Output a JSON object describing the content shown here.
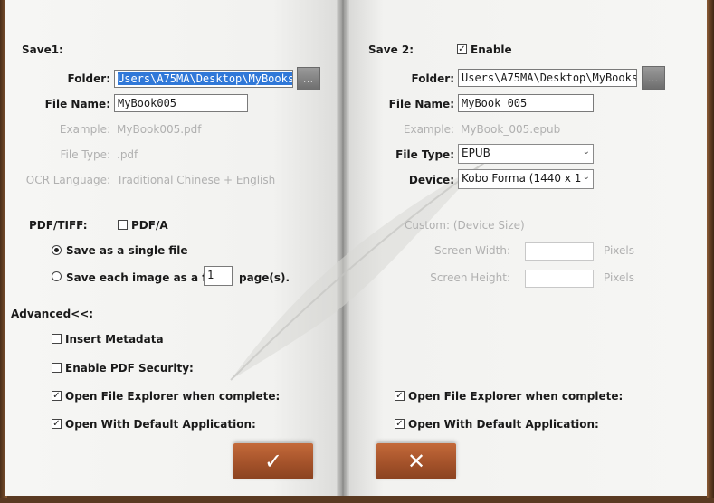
{
  "save1": {
    "title": "Save1:",
    "folder_label": "Folder:",
    "folder_value": "Users\\A75MA\\Desktop\\MyBooks",
    "filename_label": "File Name:",
    "filename_value": "MyBook005",
    "example_label": "Example:",
    "example_value": "MyBook005.pdf",
    "filetype_label": "File Type:",
    "filetype_value": ".pdf",
    "ocr_label": "OCR Language:",
    "ocr_value": "Traditional Chinese + English",
    "pdftiff_label": "PDF/TIFF:",
    "pdfa_label": "PDF/A",
    "single_file_label": "Save as a single file",
    "each_image_label": "Save each image as a fil",
    "each_image_value": "1",
    "pages_label": "page(s).",
    "advanced_label": "Advanced<<:",
    "insert_metadata_label": "Insert Metadata",
    "pdf_security_label": "Enable PDF Security:",
    "open_explorer_label": "Open File Explorer when complete:",
    "open_default_label": "Open With Default Application:"
  },
  "save2": {
    "title": "Save 2:",
    "enable_label": "Enable",
    "folder_label": "Folder:",
    "folder_value": "Users\\A75MA\\Desktop\\MyBooks",
    "filename_label": "File Name:",
    "filename_value": "MyBook_005",
    "example_label": "Example:",
    "example_value": "MyBook_005.epub",
    "filetype_label": "File Type:",
    "filetype_value": "EPUB",
    "device_label": "Device:",
    "device_value": "Kobo Forma (1440 x 1",
    "custom_label": "Custom: (Device Size)",
    "screen_width_label": "Screen Width:",
    "screen_height_label": "Screen Height:",
    "pixels_label": "Pixels",
    "open_explorer_label": "Open File Explorer when complete:",
    "open_default_label": "Open With Default Application:"
  },
  "checks": {
    "pdfa": false,
    "insert_metadata": false,
    "pdf_security": false,
    "open_explorer_1": true,
    "open_default_1": true,
    "enable_2": true,
    "open_explorer_2": true,
    "open_default_2": true
  },
  "icons": {
    "browse": "...",
    "ok": "✓",
    "cancel": "✕",
    "checkmark": "✓",
    "dropdown": "⌄"
  },
  "colors": {
    "book_leather": "#5a3a22",
    "button": "#a4522a",
    "selection": "#3078d8",
    "disabled_text": "#b0b0b0"
  }
}
